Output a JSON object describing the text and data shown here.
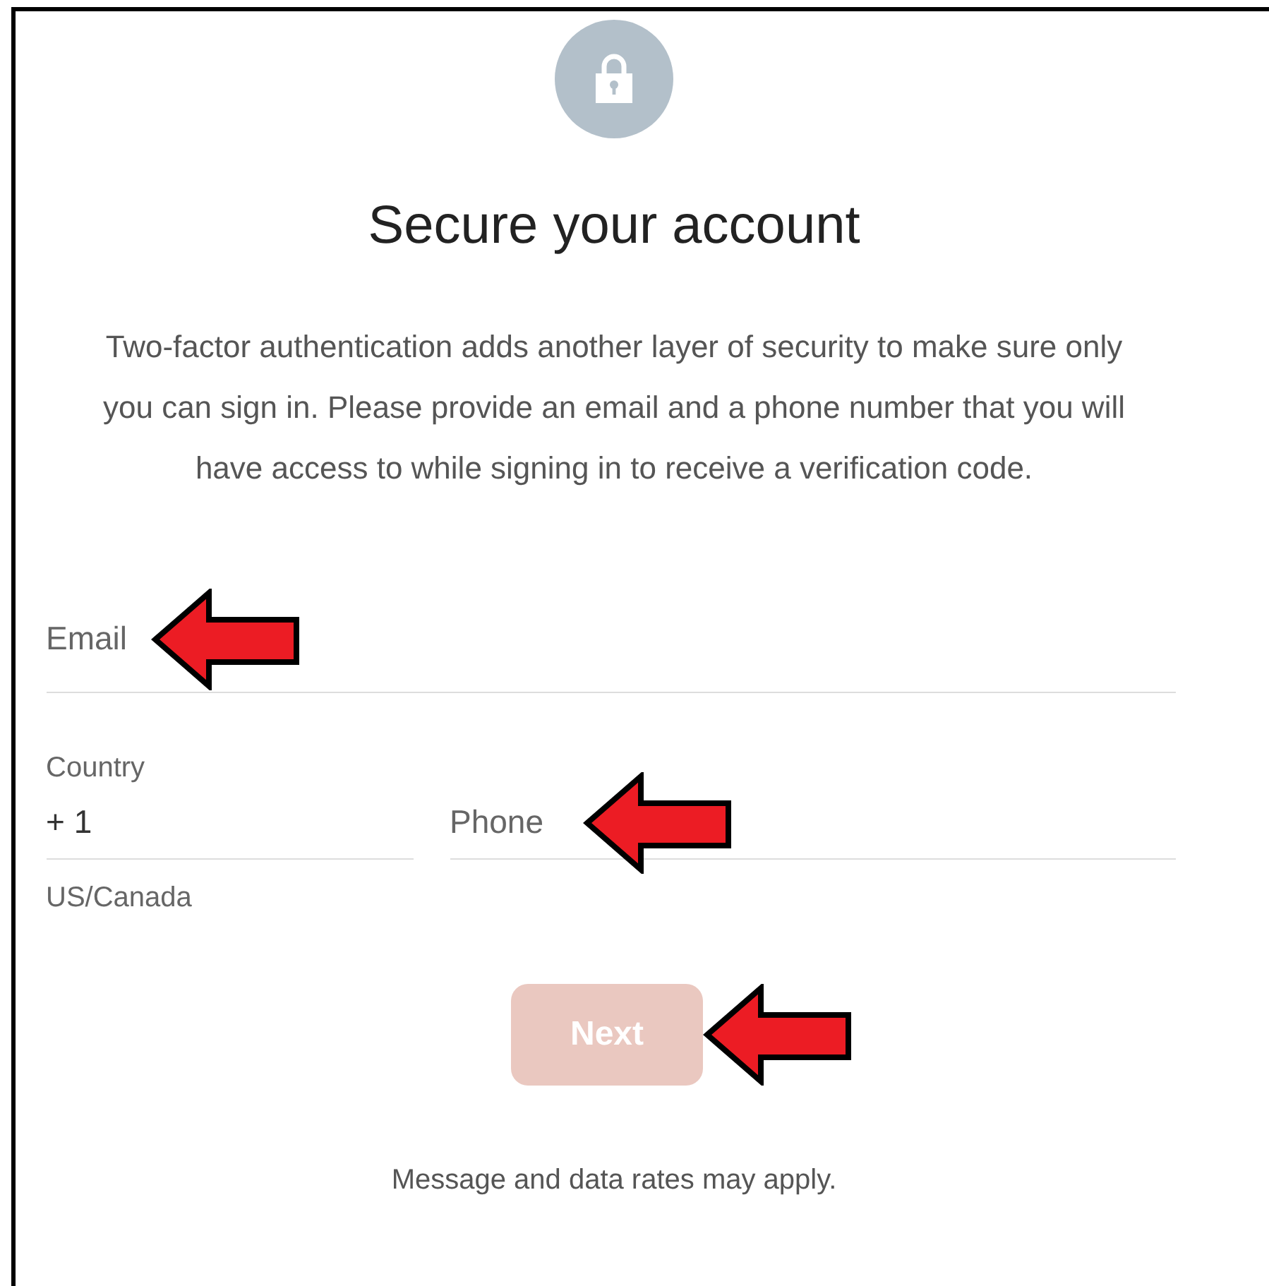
{
  "title": "Secure your account",
  "description": "Two-factor authentication adds another layer of security to make sure only you can sign in. Please provide an email and a phone number that you will have access to while signing in to receive a verification code.",
  "email": {
    "placeholder": "Email"
  },
  "country": {
    "label": "Country",
    "value": "+ 1",
    "helper": "US/Canada"
  },
  "phone": {
    "placeholder": "Phone"
  },
  "next_button": {
    "label": "Next",
    "disabled": true
  },
  "footnote": "Message and data rates may apply."
}
